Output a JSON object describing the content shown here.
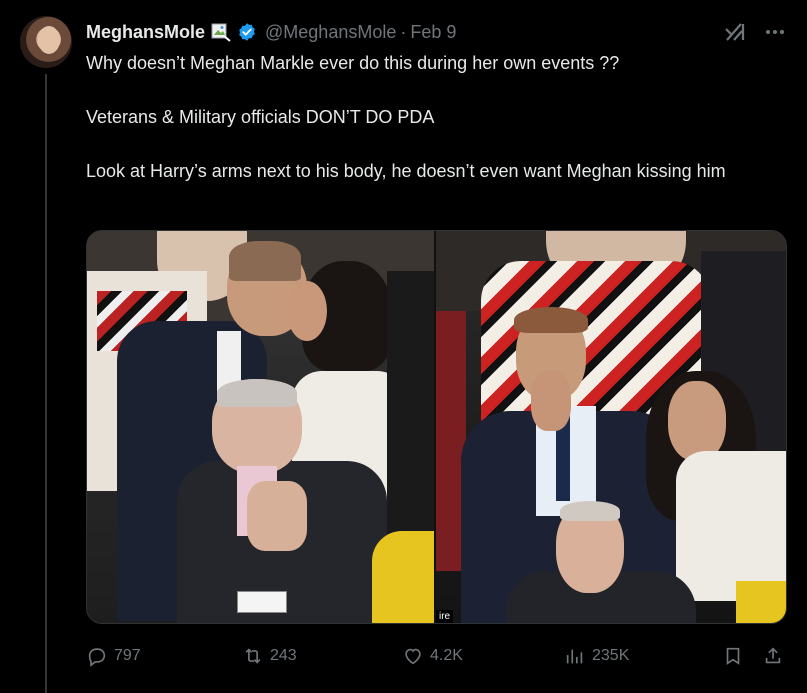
{
  "post": {
    "display_name": "MeghansMole",
    "handle": "@MeghansMole",
    "separator": "·",
    "date": "Feb 9",
    "text_lines": [
      "Why doesn’t Meghan Markle ever do this during her own events ??",
      "Veterans & Military officials DON’T DO PDA",
      "Look at Harry’s arms next to his body, he doesn’t even want Meghan kissing him"
    ],
    "media_caption": "ire"
  },
  "icons": {
    "verified": "verified-badge-icon",
    "grok": "grok-icon",
    "more": "more-options-icon",
    "reply": "reply-icon",
    "repost": "repost-icon",
    "like": "like-icon",
    "views": "views-icon",
    "bookmark": "bookmark-icon",
    "share": "share-icon"
  },
  "colors": {
    "background": "#000000",
    "text": "#e7e9ea",
    "muted": "#71767b",
    "verified_blue": "#1d9bf0"
  },
  "metrics": {
    "replies": "797",
    "reposts": "243",
    "likes": "4.2K",
    "views": "235K"
  }
}
